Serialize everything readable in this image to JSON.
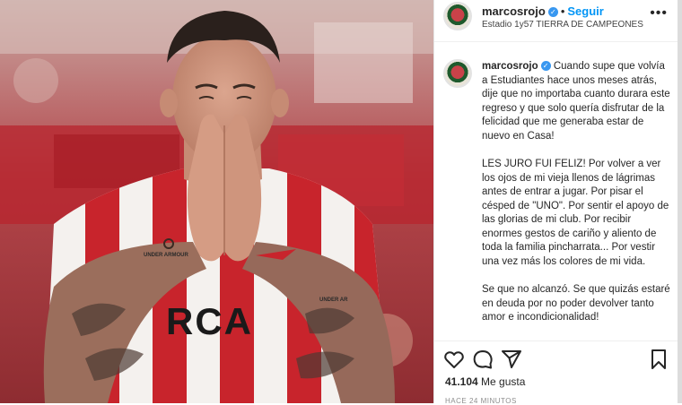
{
  "post": {
    "username": "marcosrojo",
    "follow_label": "Seguir",
    "separator": "•",
    "location": "Estadio 1y57 TIERRA DE CAMPEONES",
    "more_label": "•••",
    "photo_texts": {
      "chest_sponsor": "RCA",
      "kit_brand": "UNDER ARMOUR",
      "sleeve_text": "UNDER AR"
    },
    "caption_username": "marcosrojo",
    "caption_paragraphs": [
      "Cuando supe que volvía a Estudiantes hace unos meses atrás, dije que no importaba cuanto durara este regreso y que solo quería disfrutar de la felicidad que me generaba estar de nuevo en Casa!",
      "LES JURO FUI FELIZ! Por volver a ver los ojos de mi vieja llenos de lágrimas antes de entrar a jugar. Por pisar el césped de \"UNO\". Por sentir el apoyo de las glorias de mi club. Por recibir enormes gestos de cariño y aliento de toda la familia pincharrata... Por vestir una vez más los colores de mi vida.",
      "Se que no alcanzó. Se que quizás estaré en deuda por no poder devolver tanto amor e incondicionalidad!"
    ],
    "likes_count": "41.104",
    "likes_label": "Me gusta",
    "time_ago": "HACE 24 MINUTOS"
  },
  "icons": [
    "verified-badge-icon",
    "heart-icon",
    "comment-icon",
    "share-icon",
    "bookmark-icon",
    "more-options-icon"
  ],
  "colors": {
    "accent": "#0095f6",
    "verified": "#3897f0",
    "text": "#262626",
    "muted": "#8e8e8e",
    "kit_red": "#c8242c"
  }
}
